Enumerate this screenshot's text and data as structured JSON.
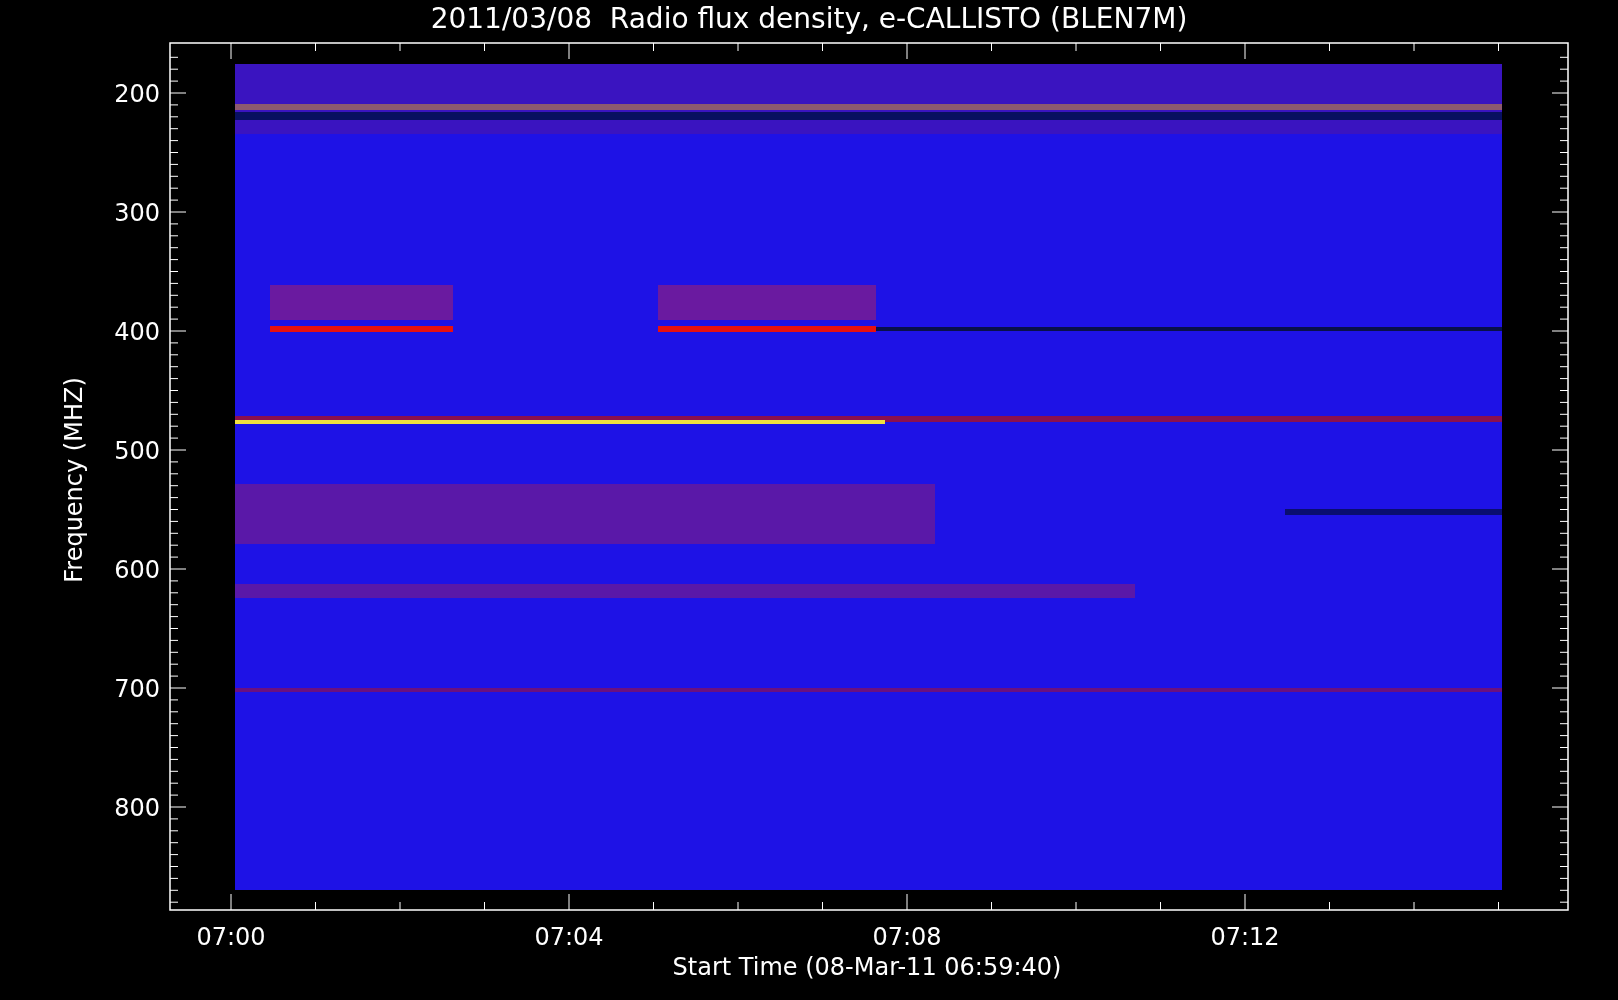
{
  "title": "2011/03/08  Radio flux density, e-CALLISTO (BLEN7M)",
  "y_axis": {
    "label": "Frequency (MHZ)",
    "ticks": [
      "200",
      "300",
      "400",
      "500",
      "600",
      "700",
      "800"
    ]
  },
  "x_axis": {
    "label": "Start Time (08-Mar-11 06:59:40)",
    "ticks": [
      "07:00",
      "07:04",
      "07:08",
      "07:12"
    ]
  }
}
